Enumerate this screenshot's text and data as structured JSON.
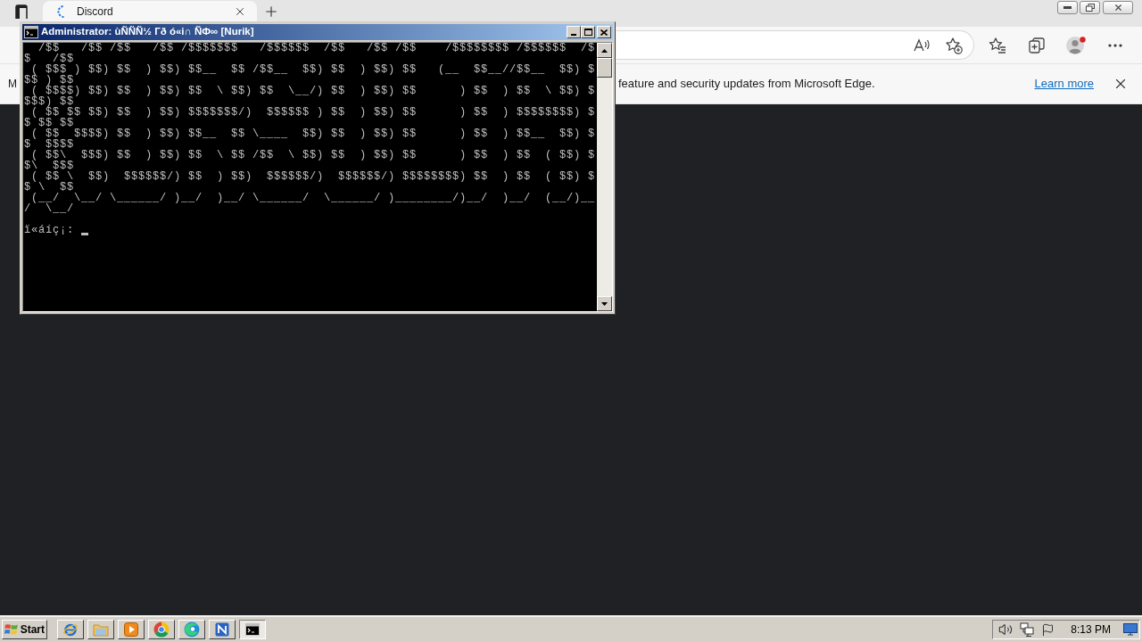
{
  "browser": {
    "tabs": [
      {
        "title": "Discord",
        "selected": true
      }
    ],
    "info_bar": {
      "text_start": "M",
      "text_end": "feature and security updates from Microsoft Edge.",
      "link": "Learn more"
    }
  },
  "console": {
    "title": "Administrator:  ùÑÑÑ½ Гð ó«i∩ ÑФ∞ [Nurik]",
    "lines": [
      "  /$$   /$$ /$$   /$$ /$$$$$$$   /$$$$$$  /$$   /$$ /$$    /$$$$$$$$ /$$$$$$  /$",
      "$   /$$",
      " ( $$$ ) $$) $$  ) $$) $$__  $$ /$$__  $$) $$  ) $$) $$   (__  $$__//$$__  $$) $",
      "$$ ) $$",
      " ( $$$$) $$) $$  ) $$) $$  \\ $$) $$  \\__/) $$  ) $$) $$      ) $$  ) $$  \\ $$) $",
      "$$$) $$",
      " ( $$ $$ $$) $$  ) $$) $$$$$$$/)  $$$$$$ ) $$  ) $$) $$      ) $$  ) $$$$$$$$) $",
      "$ $$ $$",
      " ( $$  $$$$) $$  ) $$) $$__  $$ \\____  $$) $$  ) $$) $$      ) $$  ) $$__  $$) $",
      "$  $$$$",
      " ( $$\\  $$$) $$  ) $$) $$  \\ $$ /$$  \\ $$) $$  ) $$) $$      ) $$  ) $$  ( $$) $",
      "$\\  $$$",
      " ( $$ \\  $$)  $$$$$$/) $$  ) $$)  $$$$$$/)  $$$$$$/) $$$$$$$$) $$  ) $$  ( $$) $",
      "$ \\  $$",
      " (__/  \\__/ \\______/ )__/  )__/ \\______/  \\______/ )________/)__/  )__/  (__/)__",
      "/  \\__/"
    ],
    "prompt": "ï«áíç¡:"
  },
  "taskbar": {
    "start": "Start",
    "apps": [
      {
        "kind": "ie",
        "selected": false
      },
      {
        "kind": "folder",
        "selected": false
      },
      {
        "kind": "media",
        "selected": false
      },
      {
        "kind": "chrome",
        "selected": false
      },
      {
        "kind": "edge",
        "selected": false
      },
      {
        "kind": "app",
        "selected": false
      },
      {
        "kind": "cmd",
        "selected": true
      }
    ],
    "clock": "8:13 PM"
  }
}
